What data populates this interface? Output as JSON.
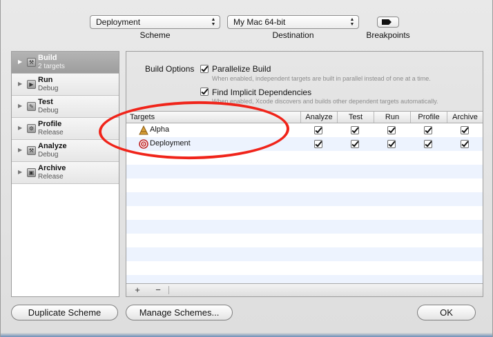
{
  "toolbar": {
    "scheme_value": "Deployment",
    "scheme_label": "Scheme",
    "destination_value": "My Mac 64-bit",
    "destination_label": "Destination",
    "breakpoints_label": "Breakpoints"
  },
  "sidebar": {
    "items": [
      {
        "name": "Build",
        "sub": "2 targets",
        "icon": "build-icon"
      },
      {
        "name": "Run",
        "sub": "Debug",
        "icon": "run-icon"
      },
      {
        "name": "Test",
        "sub": "Debug",
        "icon": "test-icon"
      },
      {
        "name": "Profile",
        "sub": "Release",
        "icon": "profile-icon"
      },
      {
        "name": "Analyze",
        "sub": "Debug",
        "icon": "analyze-icon"
      },
      {
        "name": "Archive",
        "sub": "Release",
        "icon": "archive-icon"
      }
    ]
  },
  "build_options": {
    "label": "Build Options",
    "parallelize": {
      "title": "Parallelize Build",
      "desc": "When enabled, independent targets are built in parallel instead of one at a time."
    },
    "implicit": {
      "title": "Find Implicit Dependencies",
      "desc": "When enabled, Xcode discovers and builds other dependent targets automatically."
    }
  },
  "table": {
    "columns": [
      "Targets",
      "Analyze",
      "Test",
      "Run",
      "Profile",
      "Archive"
    ],
    "rows": [
      {
        "name": "Alpha",
        "icon": "app-target-icon"
      },
      {
        "name": "Deployment",
        "icon": "aggregate-target-icon"
      }
    ]
  },
  "bottombar": {
    "add": "+",
    "remove": "−"
  },
  "buttons": {
    "duplicate": "Duplicate Scheme",
    "manage": "Manage Schemes...",
    "ok": "OK"
  },
  "annotation_color": "#f0241a"
}
